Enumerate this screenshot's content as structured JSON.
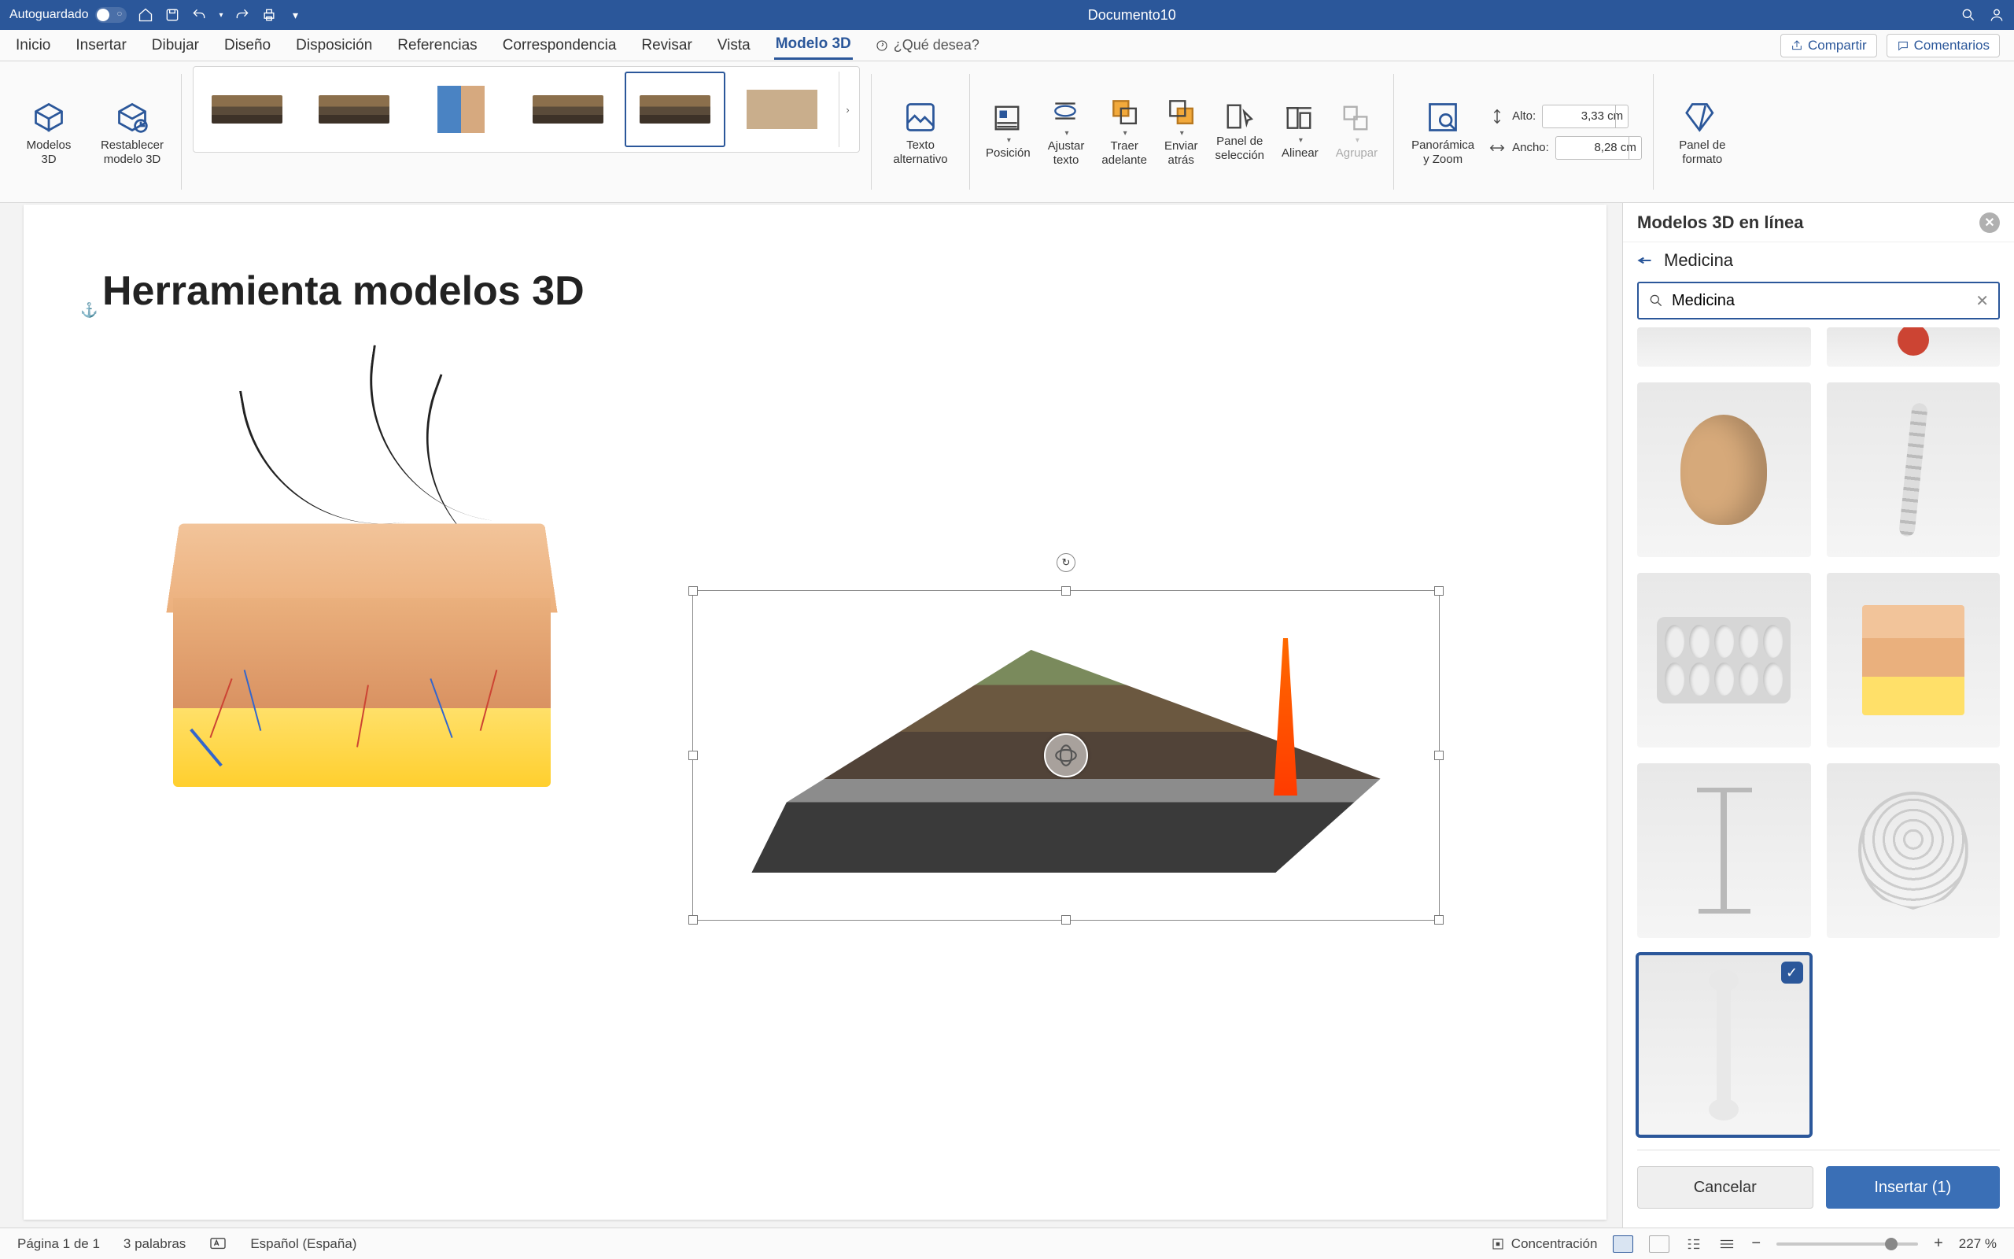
{
  "titlebar": {
    "autosave": "Autoguardado",
    "document": "Documento10"
  },
  "tabs": {
    "inicio": "Inicio",
    "insertar": "Insertar",
    "dibujar": "Dibujar",
    "diseno": "Diseño",
    "disposicion": "Disposición",
    "referencias": "Referencias",
    "correspondencia": "Correspondencia",
    "revisar": "Revisar",
    "vista": "Vista",
    "modelo3d": "Modelo 3D",
    "tellme": "¿Qué desea?",
    "compartir": "Compartir",
    "comentarios": "Comentarios"
  },
  "ribbon": {
    "modelos3d": "Modelos\n3D",
    "restablecer": "Restablecer\nmodelo 3D",
    "texto_alt": "Texto\nalternativo",
    "posicion": "Posición",
    "ajustar": "Ajustar\ntexto",
    "traer": "Traer\nadelante",
    "enviar": "Enviar\natrás",
    "panel_sel": "Panel de\nselección",
    "alinear": "Alinear",
    "agrupar": "Agrupar",
    "panoramica": "Panorámica\ny Zoom",
    "alto": "Alto:",
    "ancho": "Ancho:",
    "alto_val": "3,33 cm",
    "ancho_val": "8,28 cm",
    "panel_formato": "Panel de\nformato"
  },
  "page": {
    "heading": "Herramienta modelos 3D"
  },
  "sidepanel": {
    "title": "Modelos 3D en línea",
    "category": "Medicina",
    "search": "Medicina",
    "cancel": "Cancelar",
    "insert": "Insertar (1)"
  },
  "status": {
    "page": "Página 1 de 1",
    "words": "3 palabras",
    "lang": "Español (España)",
    "focus": "Concentración",
    "zoom": "227 %"
  }
}
